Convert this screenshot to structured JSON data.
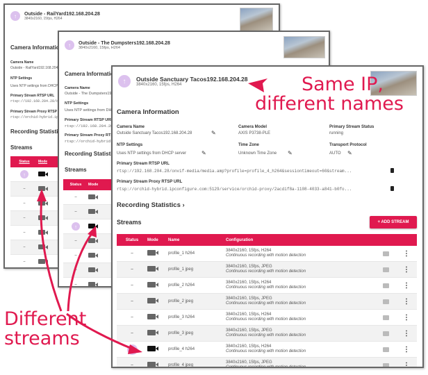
{
  "windows": [
    {
      "title": "Outside - RailYard192.168.204.28",
      "subtitle": "3840x2160, 15fps, H264",
      "camera_info": "Camera Information",
      "camera_name_label": "Camera Name",
      "camera_name": "Outside - RailYard192.168.204.28",
      "ntp_label": "NTP Settings",
      "ntp": "Uses NTP settings from DHCP server",
      "rtsp_label": "Primary Stream RTSP URL",
      "rtsp": "rtsp://192.168.204.28/onvif-media/media.amp",
      "proxy_label": "Primary Stream Proxy RTSP URL",
      "proxy": "rtsp://orchid-hybrid.ipconfigure.com",
      "rec_stats": "Recording Statistics",
      "streams": "Streams",
      "col_status": "Status",
      "col_mode": "Mode"
    },
    {
      "title": "Outside - The Dumpsters192.168.204.28",
      "subtitle": "3840x2160, 15fps, H264",
      "camera_info": "Camera Information",
      "camera_name_label": "Camera Name",
      "camera_name": "Outside - The Dumpsters192.168.204.28",
      "ntp_label": "NTP Settings",
      "ntp": "Uses NTP settings from DHCP server",
      "rtsp_label": "Primary Stream RTSP URL",
      "rtsp": "rtsp://192.168.204.28/onvif-media/media.amp",
      "proxy_label": "Primary Stream Proxy RTSP URL",
      "proxy": "rtsp://orchid-hybrid.ipconfigure.com",
      "rec_stats": "Recording Statistics",
      "streams": "Streams",
      "col_status": "Status",
      "col_mode": "Mode"
    }
  ],
  "main": {
    "title": "Outside Sanctuary Tacos192.168.204.28",
    "subtitle": "3840x2160, 15fps, H264",
    "camera_info": "Camera Information",
    "fields": {
      "camera_name_label": "Camera Name",
      "camera_name": "Outside Sanctuary Tacos192.168.204.28",
      "camera_model_label": "Camera Model",
      "camera_model": "AXIS P3738-PLE",
      "status_label": "Primary Stream Status",
      "status": "running",
      "ntp_label": "NTP Settings",
      "ntp": "Uses NTP settings from DHCP server",
      "tz_label": "Time Zone",
      "tz": "Unknown Time Zone",
      "transport_label": "Transport Protocol",
      "transport": "AUTO",
      "rtsp_label": "Primary Stream RTSP URL",
      "rtsp": "rtsp://192.168.204.28/onvif-media/media.amp?profile=profile_4_h264&sessiontimeout=60&stream...",
      "proxy_label": "Primary Stream Proxy RTSP URL",
      "proxy": "rtsp://orchid-hybrid.ipconfigure.com:5129/service/orchid-proxy/2acdif8a-1108-4033-a841-b0fo..."
    },
    "rec_stats": "Recording Statistics",
    "streams": "Streams",
    "add_stream": "+ ADD STREAM",
    "columns": [
      "Status",
      "Mode",
      "Name",
      "Configuration"
    ],
    "rows": [
      {
        "name": "profile_1 h264",
        "config": "3840x2160, 15fps, H264",
        "desc": "Continuous recording with motion detection",
        "active": false
      },
      {
        "name": "profile_1 jpeg",
        "config": "3840x2160, 15fps, JPEG",
        "desc": "Continuous recording with motion detection",
        "active": false
      },
      {
        "name": "profile_2 h264",
        "config": "3840x2160, 15fps, H264",
        "desc": "Continuous recording with motion detection",
        "active": false
      },
      {
        "name": "profile_2 jpeg",
        "config": "3840x2160, 15fps, JPEG",
        "desc": "Continuous recording with motion detection",
        "active": false
      },
      {
        "name": "profile_3 h264",
        "config": "3840x2160, 15fps, H264",
        "desc": "Continuous recording with motion detection",
        "active": false
      },
      {
        "name": "profile_3 jpeg",
        "config": "3840x2160, 15fps, JPEG",
        "desc": "Continuous recording with motion detection",
        "active": false
      },
      {
        "name": "profile_4 h264",
        "config": "3840x2160, 15fps, H264",
        "desc": "Continuous recording with motion detection",
        "active": true
      },
      {
        "name": "profile_4 jpeg",
        "config": "3840x2160, 15fps, JPEG",
        "desc": "Continuous recording with motion detection",
        "active": false
      }
    ]
  },
  "annotations": {
    "same_ip": "Same IP,",
    "diff_names": "different names",
    "different": "Different",
    "streams": "streams"
  },
  "colors": {
    "accent": "#e0194f",
    "avatar": "#dcc1ee"
  }
}
